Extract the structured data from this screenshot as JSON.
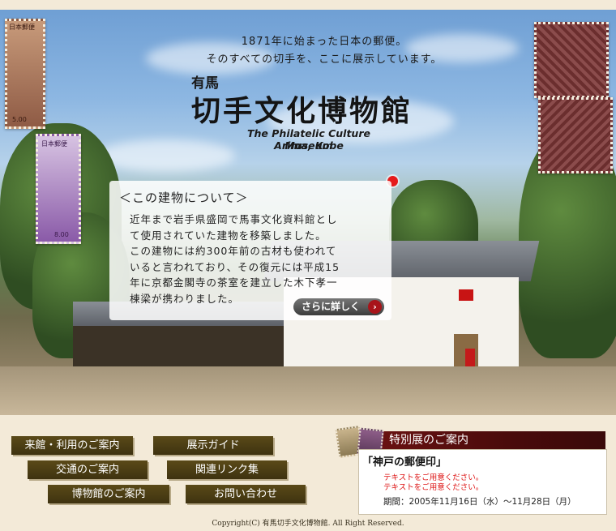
{
  "hero": {
    "tagline_1": "1871年に始まった日本の郵便。",
    "tagline_2": "そのすべての切手を、ここに展示しています。",
    "sub_title": "有馬",
    "main_title": "切手文化博物館",
    "english_name": "The Philatelic Culture Museum",
    "english_location": "Arima, Kobe",
    "stamps": {
      "top_left_label": "日本郵便",
      "top_left_value": "5.00",
      "mid_left_label": "日本郵便",
      "mid_left_value": "8.00"
    }
  },
  "info": {
    "title": "＜この建物について＞",
    "lines": [
      "近年まで岩手県盛岡で馬事文化資料館とし",
      "て使用されていた建物を移築しました。",
      "この建物には約300年前の古材も使われて",
      "いると言われており、その復元には平成15",
      "年に京都金閣寺の茶室を建立した木下孝一",
      "棟梁が携わりました。"
    ],
    "more_label": "さらに詳しく",
    "more_arrow": "›"
  },
  "nav": {
    "visit": "来館・利用のご案内",
    "guide": "展示ガイド",
    "access": "交通のご案内",
    "links": "関連リンク集",
    "museum": "博物館のご案内",
    "contact": "お問い合わせ"
  },
  "exhibition": {
    "header": "特別展のご案内",
    "title": "「神戸の郵便印」",
    "note_1": "テキストをご用意ください。",
    "note_2": "テキストをご用意ください。",
    "period": "期間：2005年11月16日（水）～11月28日（月）"
  },
  "footer": {
    "copyright": "Copyright(C) 有馬切手文化博物館. All Right Reserved."
  },
  "colors": {
    "background": "#f3ead8",
    "nav_button": "#4b3d14",
    "exhibition_header": "#5e1010",
    "red_dot": "#e51b1b",
    "note_text": "#dd1111"
  }
}
